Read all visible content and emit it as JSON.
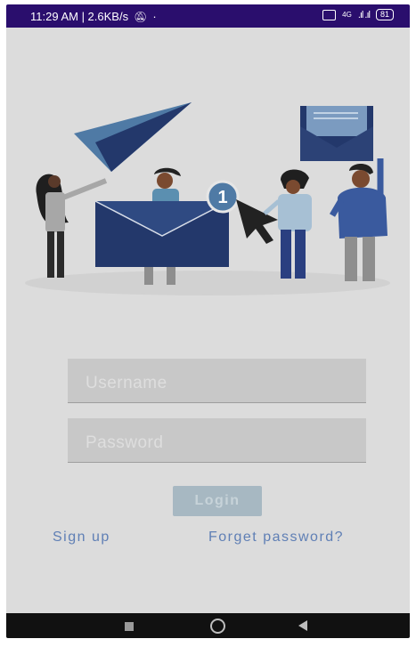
{
  "status_bar": {
    "time_speed": "11:29 AM | 2.6KB/s",
    "network_label": "4G",
    "battery": "81"
  },
  "login_form": {
    "title": "",
    "username_placeholder": "Username",
    "password_placeholder": "Password",
    "login_label": "Login",
    "signup_label": "Sign up",
    "forget_label": "Forget password?"
  },
  "illustration": {
    "badge_count": "1"
  },
  "colors": {
    "status_bar": "#2a0e6d",
    "background": "#dcdcdc",
    "accent_link": "#5f7fb5",
    "illustration_navy": "#23386b"
  },
  "icons": {
    "status": [
      "mute-icon",
      "dot-icon",
      "volte-icon",
      "signal-icon",
      "battery-icon"
    ],
    "nav": [
      "recents-icon",
      "home-icon",
      "back-icon"
    ]
  }
}
